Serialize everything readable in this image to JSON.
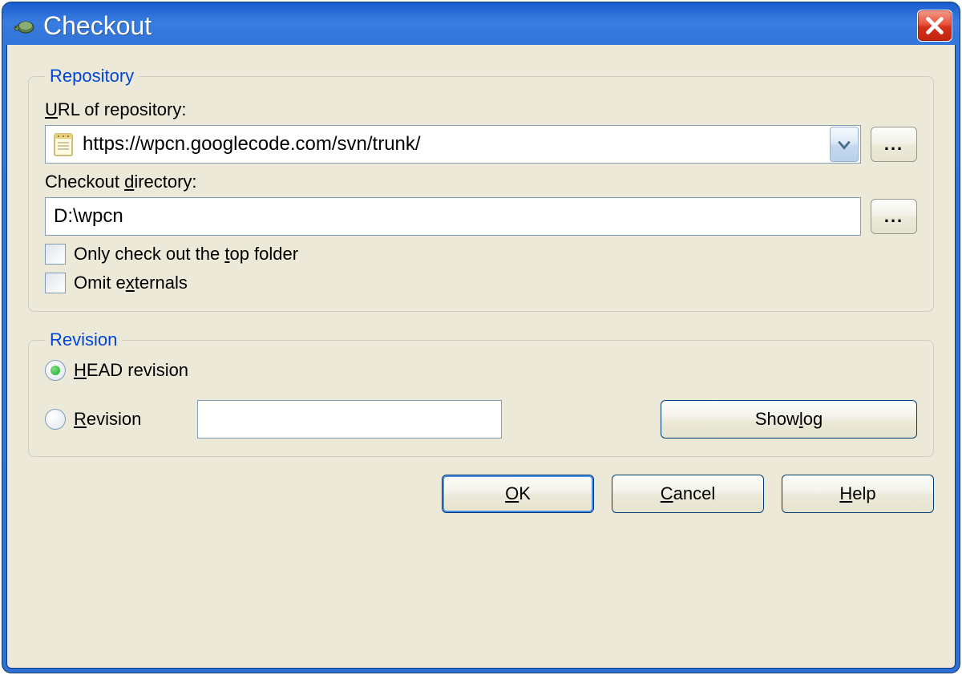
{
  "window": {
    "title": "Checkout"
  },
  "repository": {
    "legend": "Repository",
    "url_label": "URL of repository:",
    "url_value": "https://wpcn.googlecode.com/svn/trunk/",
    "dir_label": "Checkout directory:",
    "dir_value": "D:\\wpcn",
    "top_folder_label": "Only check out the top folder",
    "omit_externals_label": "Omit externals",
    "browse": "..."
  },
  "revision": {
    "legend": "Revision",
    "head_label": "HEAD revision",
    "rev_label": "Revision",
    "rev_value": "",
    "show_log": "Show log"
  },
  "buttons": {
    "ok": "OK",
    "cancel": "Cancel",
    "help": "Help"
  },
  "underline": {
    "url_u": "U",
    "url_rest": "RL of repository:",
    "dir_pre": "Checkout ",
    "dir_u": "d",
    "dir_rest": "irectory:",
    "top_pre": "Only check out the ",
    "top_u": "t",
    "top_rest": "op folder",
    "omit_pre": "Omit e",
    "omit_u": "x",
    "omit_rest": "ternals",
    "head_u": "H",
    "head_rest": "EAD revision",
    "rev_u": "R",
    "rev_rest": "evision",
    "log_pre": "Show ",
    "log_u": "l",
    "log_rest": "og",
    "ok_u": "O",
    "ok_rest": "K",
    "cancel_u": "C",
    "cancel_rest": "ancel",
    "help_u": "H",
    "help_rest": "elp"
  }
}
